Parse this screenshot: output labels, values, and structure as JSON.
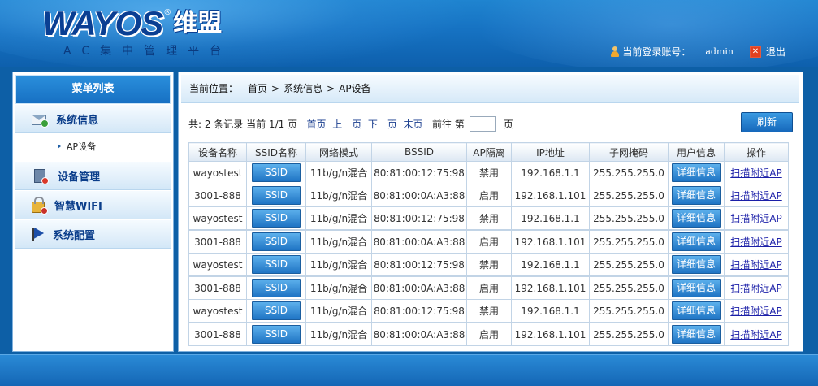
{
  "brand": {
    "logo_word": "WAYOS",
    "logo_reg": "®",
    "logo_cn": "维盟",
    "subtitle": "AC集中管理平台"
  },
  "userbar": {
    "login_label": "当前登录账号：",
    "username": "admin",
    "logout_label": "退出",
    "logout_icon_glyph": "✕"
  },
  "sidebar": {
    "title": "菜单列表",
    "items": [
      {
        "label": "系统信息",
        "icon": "mail-icon"
      },
      {
        "label": "AP设备",
        "sub": true
      },
      {
        "label": "设备管理",
        "icon": "device-icon"
      },
      {
        "label": "智慧WIFI",
        "icon": "lock-icon"
      },
      {
        "label": "系统配置",
        "icon": "flag-icon"
      }
    ]
  },
  "breadcrumb": {
    "prefix": "当前位置：",
    "items": [
      "首页",
      "系统信息",
      "AP设备"
    ],
    "sep": ">"
  },
  "pager": {
    "summary": "共: 2 条记录 当前 1/1 页",
    "first": "首页",
    "prev": "上一页",
    "next": "下一页",
    "last": "末页",
    "goto_prefix": "前往 第",
    "goto_value": "",
    "goto_suffix": "页",
    "refresh": "刷新"
  },
  "table": {
    "headers": [
      "设备名称",
      "SSID名称",
      "网络模式",
      "BSSID",
      "AP隔离",
      "IP地址",
      "子网掩码",
      "用户信息",
      "操作"
    ],
    "ssid_button": "SSID",
    "detail_button": "详细信息",
    "action_link": "扫描附近AP",
    "rows": [
      {
        "name": "wayostest",
        "mode": "11b/g/n混合",
        "bssid": "80:81:00:12:75:98",
        "isolation": "禁用",
        "ip": "192.168.1.1",
        "mask": "255.255.255.0"
      },
      {
        "name": "3001-888",
        "mode": "11b/g/n混合",
        "bssid": "80:81:00:0A:A3:88",
        "isolation": "启用",
        "ip": "192.168.1.101",
        "mask": "255.255.255.0"
      },
      {
        "name": "wayostest",
        "mode": "11b/g/n混合",
        "bssid": "80:81:00:12:75:98",
        "isolation": "禁用",
        "ip": "192.168.1.1",
        "mask": "255.255.255.0"
      },
      {
        "name": "3001-888",
        "mode": "11b/g/n混合",
        "bssid": "80:81:00:0A:A3:88",
        "isolation": "启用",
        "ip": "192.168.1.101",
        "mask": "255.255.255.0"
      },
      {
        "name": "wayostest",
        "mode": "11b/g/n混合",
        "bssid": "80:81:00:12:75:98",
        "isolation": "禁用",
        "ip": "192.168.1.1",
        "mask": "255.255.255.0"
      },
      {
        "name": "3001-888",
        "mode": "11b/g/n混合",
        "bssid": "80:81:00:0A:A3:88",
        "isolation": "启用",
        "ip": "192.168.1.101",
        "mask": "255.255.255.0"
      },
      {
        "name": "wayostest",
        "mode": "11b/g/n混合",
        "bssid": "80:81:00:12:75:98",
        "isolation": "禁用",
        "ip": "192.168.1.1",
        "mask": "255.255.255.0"
      },
      {
        "name": "3001-888",
        "mode": "11b/g/n混合",
        "bssid": "80:81:00:0A:A3:88",
        "isolation": "启用",
        "ip": "192.168.1.101",
        "mask": "255.255.255.0"
      }
    ]
  },
  "colors": {
    "brand_blue": "#1672c2",
    "button_blue": "#1f74c4",
    "link_blue": "#1b1fa8"
  }
}
